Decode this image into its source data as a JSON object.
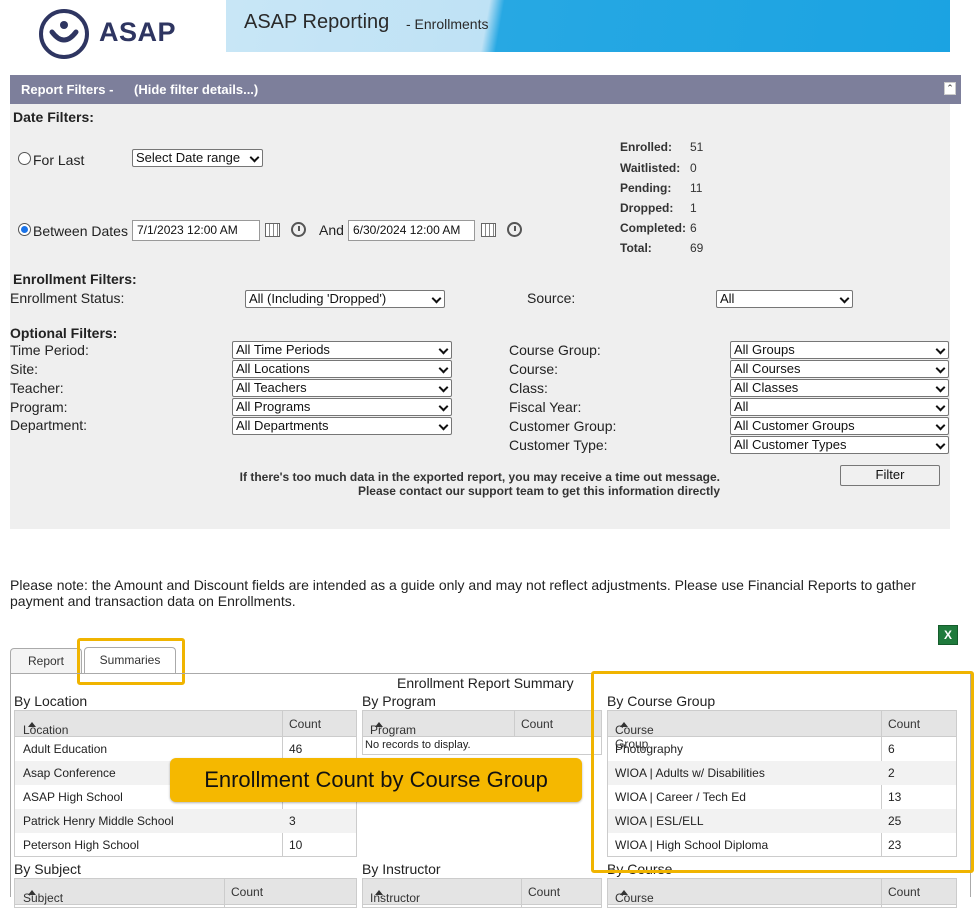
{
  "header": {
    "logo_text": "ASAP",
    "title": "ASAP Reporting",
    "subtitle": "- Enrollments"
  },
  "filters_bar": {
    "title": "Report Filters -",
    "toggle_link": "(Hide filter details...)"
  },
  "date_filters": {
    "heading": "Date Filters:",
    "for_last_label": "For Last",
    "date_range_select": "Select Date range",
    "between_label": "Between Dates",
    "start_value": "7/1/2023 12:00 AM",
    "and_label": "And",
    "end_value": "6/30/2024 12:00 AM"
  },
  "stats": [
    {
      "label": "Enrolled:",
      "value": "51"
    },
    {
      "label": "Waitlisted:",
      "value": "0"
    },
    {
      "label": "Pending:",
      "value": "11"
    },
    {
      "label": "Dropped:",
      "value": "1"
    },
    {
      "label": "Completed:",
      "value": "6"
    },
    {
      "label": "Total:",
      "value": "69"
    }
  ],
  "enrollment_filters": {
    "heading": "Enrollment Filters:",
    "status_label": "Enrollment Status:",
    "status_value": "All (Including 'Dropped')",
    "source_label": "Source:",
    "source_value": "All"
  },
  "optional_filters": {
    "heading": "Optional Filters:",
    "left": [
      {
        "label": "Time Period:",
        "value": "All Time Periods"
      },
      {
        "label": "Site:",
        "value": "All Locations"
      },
      {
        "label": "Teacher:",
        "value": "All Teachers"
      },
      {
        "label": "Program:",
        "value": "All Programs"
      },
      {
        "label": "Department:",
        "value": "All Departments"
      }
    ],
    "right": [
      {
        "label": "Course Group:",
        "value": "All Groups"
      },
      {
        "label": "Course:",
        "value": "All Courses"
      },
      {
        "label": "Class:",
        "value": "All Classes"
      },
      {
        "label": "Fiscal Year:",
        "value": "All"
      },
      {
        "label": "Customer Group:",
        "value": "All Customer Groups"
      },
      {
        "label": "Customer Type:",
        "value": "All Customer Types"
      }
    ]
  },
  "timeout_note": {
    "line1": "If there's too much data in the exported report, you may receive a time out message.",
    "line2": "Please contact our support team to get this information directly"
  },
  "filter_button": "Filter",
  "notice": "Please note: the Amount and Discount fields are intended as a guide only and may not reflect adjustments. Please use Financial Reports to gather payment and transaction data on Enrollments.",
  "tabs": [
    "Report",
    "Summaries"
  ],
  "summary": {
    "title": "Enrollment Report Summary",
    "by_location": {
      "title": "By Location",
      "col1": "Location",
      "col2": "Count",
      "rows": [
        {
          "name": "Adult Education",
          "count": "46"
        },
        {
          "name": "Asap Conference",
          "count": ""
        },
        {
          "name": "ASAP High School",
          "count": ""
        },
        {
          "name": "Patrick Henry Middle School",
          "count": "3"
        },
        {
          "name": "Peterson High School",
          "count": "10"
        }
      ]
    },
    "by_program": {
      "title": "By Program",
      "col1": "Program",
      "col2": "Count",
      "empty": "No records to display."
    },
    "by_course_group": {
      "title": "By Course Group",
      "col1": "Course Group",
      "col2": "Count",
      "rows": [
        {
          "name": "Photography",
          "count": "6"
        },
        {
          "name": "WIOA | Adults w/ Disabilities",
          "count": "2"
        },
        {
          "name": "WIOA | Career / Tech Ed",
          "count": "13"
        },
        {
          "name": "WIOA | ESL/ELL",
          "count": "25"
        },
        {
          "name": "WIOA | High School Diploma",
          "count": "23"
        }
      ]
    },
    "by_subject": {
      "title": "By Subject",
      "col1": "Subject",
      "col2": "Count"
    },
    "by_instructor": {
      "title": "By Instructor",
      "col1": "Instructor",
      "col2": "Count"
    },
    "by_course": {
      "title": "By Course",
      "col1": "Course",
      "col2": "Count"
    }
  },
  "callout": "Enrollment Count by Course Group"
}
